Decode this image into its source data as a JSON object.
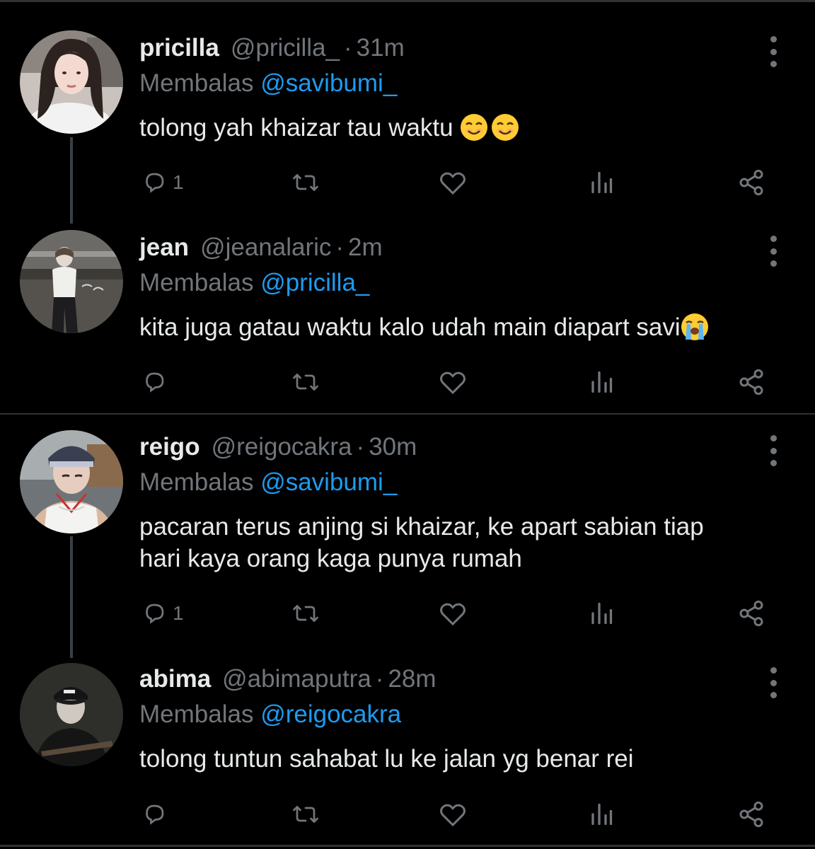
{
  "colors": {
    "background": "#000000",
    "primary_text": "#e7e9ea",
    "secondary_text": "#71767b",
    "mention": "#1d9bf0",
    "divider": "#2f3336"
  },
  "icons": {
    "reply": "reply-icon",
    "retweet": "retweet-icon",
    "like": "heart-icon",
    "views": "analytics-icon",
    "share": "share-icon",
    "more": "more-vertical-icon"
  },
  "reply_prefix": "Membalas",
  "tweets": [
    {
      "name": "pricilla",
      "handle": "@pricilla_",
      "time": "31m",
      "separator": "·",
      "reply_to": "@savibumi_",
      "text": "tolong yah khaizar tau waktu",
      "emoji": [
        "smiling-face-emoji",
        "smiling-face-emoji"
      ],
      "reply_count": "1"
    },
    {
      "name": "jean",
      "handle": "@jeanalaric",
      "time": "2m",
      "separator": "·",
      "reply_to": "@pricilla_",
      "text": "kita juga gatau waktu kalo udah main diapart savi",
      "emoji": [
        "loudly-crying-face-emoji"
      ],
      "reply_count": ""
    },
    {
      "name": "reigo",
      "handle": "@reigocakra",
      "time": "30m",
      "separator": "·",
      "reply_to": "@savibumi_",
      "text_line1": "pacaran terus anjing si khaizar, ke apart sabian tiap",
      "text_line2": "hari kaya orang kaga punya rumah",
      "reply_count": "1"
    },
    {
      "name": "abima",
      "handle": "@abimaputra",
      "time": "28m",
      "separator": "·",
      "reply_to": "@reigocakra",
      "text": "tolong tuntun sahabat lu ke jalan yg benar rei",
      "reply_count": ""
    }
  ]
}
